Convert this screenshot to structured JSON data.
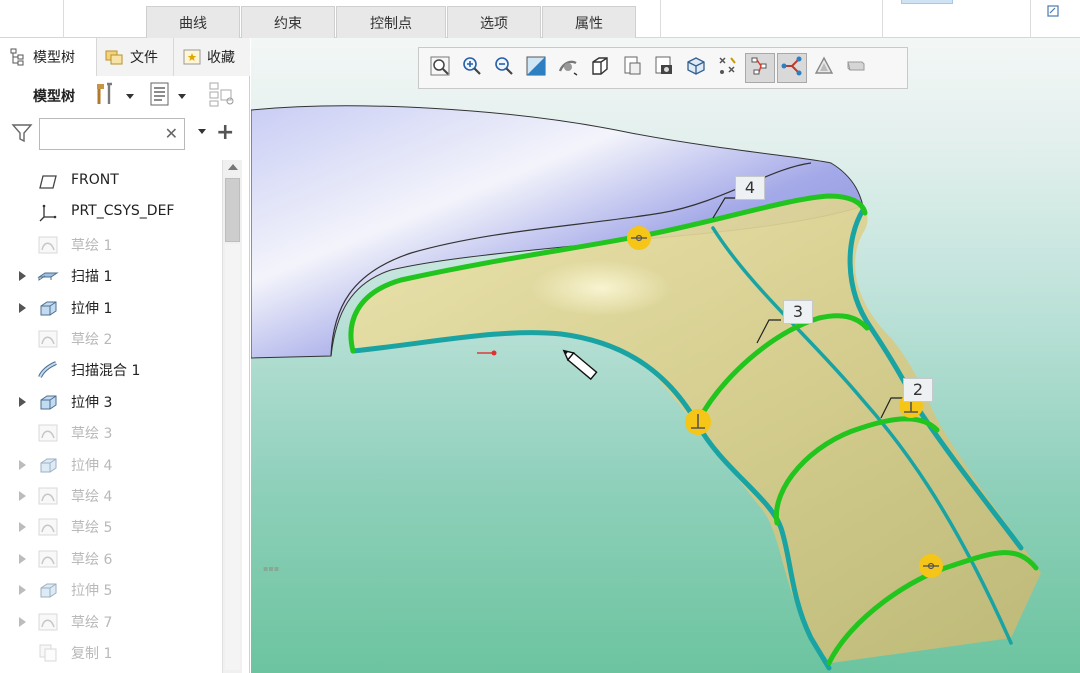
{
  "ribbon": {
    "tabs": [
      {
        "label": "曲线"
      },
      {
        "label": "约束"
      },
      {
        "label": "控制点"
      },
      {
        "label": "选项"
      },
      {
        "label": "属性"
      }
    ]
  },
  "left_panel": {
    "tabs": [
      {
        "label": "模型树",
        "icon": "tree-structure-icon"
      },
      {
        "label": "文件",
        "icon": "folder-files-icon"
      },
      {
        "label": "收藏",
        "icon": "favorites-icon"
      }
    ],
    "toolbar_title": "模型树",
    "filter": {
      "value": "",
      "placeholder": ""
    },
    "tree_items": [
      {
        "label": "FRONT",
        "icon": "datum-plane-icon",
        "expandable": false,
        "dim": false
      },
      {
        "label": "PRT_CSYS_DEF",
        "icon": "coordinate-system-icon",
        "expandable": false,
        "dim": false
      },
      {
        "label": "草绘 1",
        "icon": "sketch-icon",
        "expandable": false,
        "dim": true
      },
      {
        "label": "扫描 1",
        "icon": "sweep-icon",
        "expandable": true,
        "dim": false
      },
      {
        "label": "拉伸 1",
        "icon": "extrude-icon",
        "expandable": true,
        "dim": false
      },
      {
        "label": "草绘 2",
        "icon": "sketch-icon",
        "expandable": false,
        "dim": true
      },
      {
        "label": "扫描混合 1",
        "icon": "swept-blend-icon",
        "expandable": false,
        "dim": false
      },
      {
        "label": "拉伸 3",
        "icon": "extrude-icon",
        "expandable": true,
        "dim": false
      },
      {
        "label": "草绘 3",
        "icon": "sketch-icon",
        "expandable": false,
        "dim": true
      },
      {
        "label": "拉伸 4",
        "icon": "extrude-icon",
        "expandable": true,
        "dim": true
      },
      {
        "label": "草绘 4",
        "icon": "sketch-icon",
        "expandable": true,
        "dim": true
      },
      {
        "label": "草绘 5",
        "icon": "sketch-icon",
        "expandable": true,
        "dim": true
      },
      {
        "label": "草绘 6",
        "icon": "sketch-icon",
        "expandable": true,
        "dim": true
      },
      {
        "label": "拉伸 5",
        "icon": "extrude-icon",
        "expandable": true,
        "dim": true
      },
      {
        "label": "草绘 7",
        "icon": "sketch-icon",
        "expandable": true,
        "dim": true
      },
      {
        "label": "复制 1",
        "icon": "copy-icon",
        "expandable": false,
        "dim": true
      }
    ]
  },
  "view_toolbar": {
    "buttons": [
      {
        "icon": "zoom-fit-icon"
      },
      {
        "icon": "zoom-in-icon"
      },
      {
        "icon": "zoom-out-icon"
      },
      {
        "icon": "repaint-icon"
      },
      {
        "icon": "spin-center-icon"
      },
      {
        "icon": "view-orientation-icon"
      },
      {
        "icon": "saved-views-icon"
      },
      {
        "icon": "display-style-icon"
      },
      {
        "icon": "section-view-icon"
      },
      {
        "icon": "datum-display-icon"
      },
      {
        "icon": "control-polygon-icon"
      },
      {
        "icon": "curve-connections-icon"
      },
      {
        "icon": "shading-analysis-icon"
      },
      {
        "icon": "appearance-icon"
      }
    ]
  },
  "viewport": {
    "dimension_labels": [
      "4",
      "3",
      "2"
    ],
    "colors": {
      "surface_fill": "#d8cd8c",
      "blue_body": "#a6abea",
      "boundary_curve": "#1aa3a3",
      "cross_curve": "#22c41e",
      "constraint_marker": "#f5c518"
    }
  }
}
